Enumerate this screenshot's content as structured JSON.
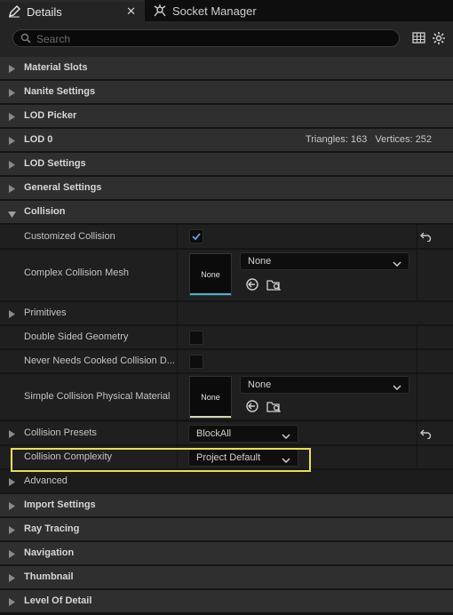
{
  "tabs": [
    {
      "label": "Details",
      "close": "✕"
    },
    {
      "label": "Socket Manager"
    }
  ],
  "search": {
    "placeholder": "Search"
  },
  "categories": {
    "material_slots": "Material Slots",
    "nanite_settings": "Nanite Settings",
    "lod_picker": "LOD Picker",
    "lod0": "LOD 0",
    "lod0_stats": "Triangles: 163   Vertices: 252",
    "lod_settings": "LOD Settings",
    "general_settings": "General Settings",
    "collision": "Collision",
    "primitives": "Primitives",
    "collision_presets": "Collision Presets",
    "advanced": "Advanced",
    "import_settings": "Import Settings",
    "ray_tracing": "Ray Tracing",
    "navigation": "Navigation",
    "thumbnail": "Thumbnail",
    "level_of_detail": "Level Of Detail"
  },
  "props": {
    "customized_collision": {
      "label": "Customized Collision",
      "checked": true
    },
    "complex_collision_mesh": {
      "label": "Complex Collision Mesh",
      "thumb": "None",
      "value": "None",
      "accent": "#3fb6d8"
    },
    "double_sided_geometry": {
      "label": "Double Sided Geometry",
      "checked": false
    },
    "never_needs_cooked": {
      "label": "Never Needs Cooked Collision D...",
      "checked": false
    },
    "simple_collision_phys_mat": {
      "label": "Simple Collision Physical Material",
      "thumb": "None",
      "value": "None",
      "accent": "#d6d6b8"
    },
    "collision_presets_value": "BlockAll",
    "collision_complexity": {
      "label": "Collision Complexity",
      "value": "Project Default"
    }
  },
  "highlight_color": "#e6e34a"
}
